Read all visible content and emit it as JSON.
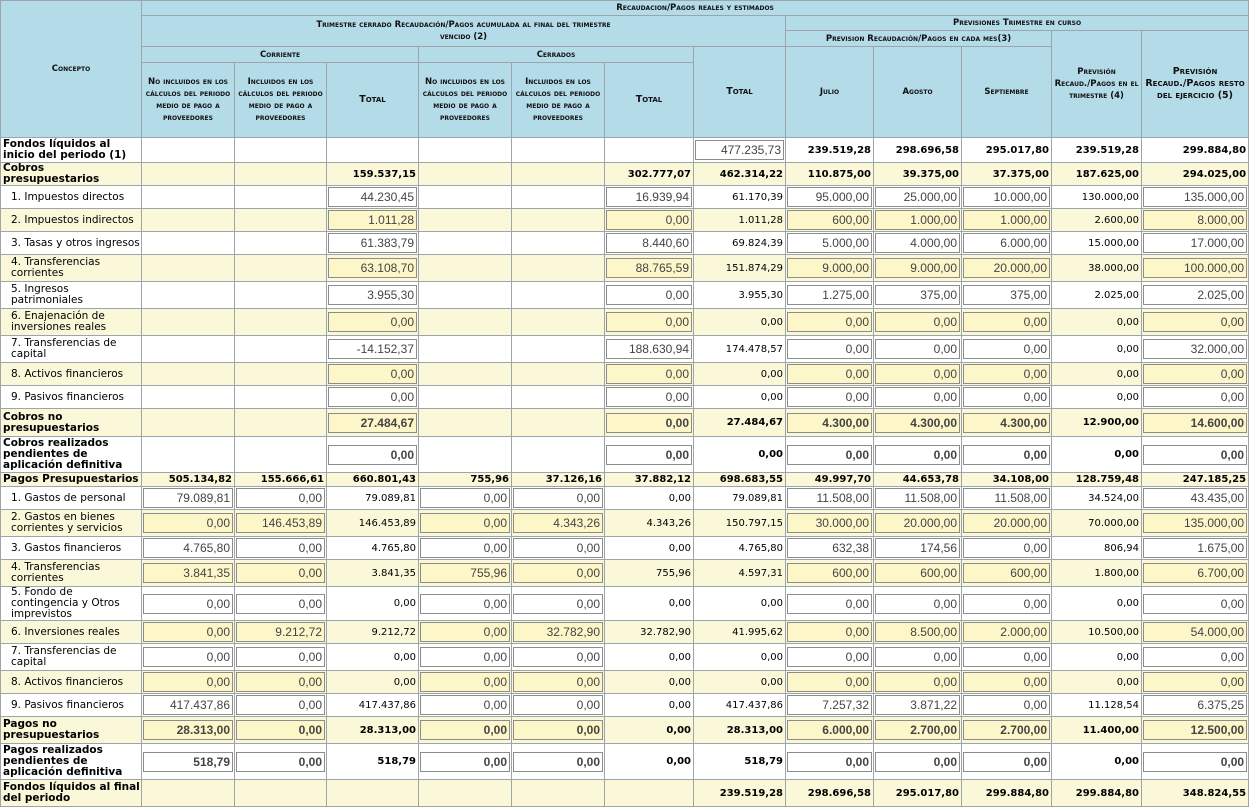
{
  "header": {
    "concepto": "Concepto",
    "main_title": "Recaudacion/Pagos reales y estimados",
    "trimestre_cerrado": "Trimestre cerrado Recaudación/Pagos acumulada al final del trimestre vencido (2)",
    "corriente": "Corriente",
    "cerrados": "Cerrados",
    "no_incluidos": "No incluidos en los cálculos del periodo medio de pago a proveedores",
    "incluidos": "Incluidos en los cálculos del periodo medio de pago a proveedores",
    "total": "Total",
    "previsiones": "Previsiones Trimestre en curso",
    "prevision_mes": "Prevision Recaudación/Pagos en cada mes(3)",
    "julio": "Julio",
    "agosto": "Agosto",
    "septiembre": "Septiembre",
    "prevision_trimestre": "Previsión Recaud./Pagos en el trimestre (4)",
    "prevision_resto": "Previsión Recaud./Pagos resto del ejercicio (5)"
  },
  "rows": [
    {
      "label": "Fondos líquidos al inicio del periodo (1)",
      "bold": true,
      "yellow": false,
      "cells": [
        "",
        "",
        "",
        "",
        "",
        "",
        "477.235,73",
        "239.519,28",
        "298.696,58",
        "295.017,80",
        "239.519,28",
        "299.884,80"
      ],
      "types": [
        "e",
        "e",
        "e",
        "e",
        "e",
        "e",
        "i",
        "b",
        "b",
        "b",
        "b",
        "b"
      ]
    },
    {
      "label": "Cobros presupuestarios",
      "bold": true,
      "yellow": true,
      "cells": [
        "",
        "",
        "159.537,15",
        "",
        "",
        "302.777,07",
        "462.314,22",
        "110.875,00",
        "39.375,00",
        "37.375,00",
        "187.625,00",
        "294.025,00"
      ],
      "types": [
        "e",
        "e",
        "b",
        "e",
        "e",
        "b",
        "b",
        "b",
        "b",
        "b",
        "b",
        "b"
      ]
    },
    {
      "label": "1. Impuestos directos",
      "bold": false,
      "yellow": false,
      "cells": [
        "",
        "",
        "44.230,45",
        "",
        "",
        "16.939,94",
        "61.170,39",
        "95.000,00",
        "25.000,00",
        "10.000,00",
        "130.000,00",
        "135.000,00"
      ],
      "types": [
        "e",
        "e",
        "i",
        "e",
        "e",
        "i",
        "v",
        "i",
        "i",
        "i",
        "v",
        "i"
      ]
    },
    {
      "label": "2. Impuestos indirectos",
      "bold": false,
      "yellow": true,
      "cells": [
        "",
        "",
        "1.011,28",
        "",
        "",
        "0,00",
        "1.011,28",
        "600,00",
        "1.000,00",
        "1.000,00",
        "2.600,00",
        "8.000,00"
      ],
      "types": [
        "e",
        "e",
        "i",
        "e",
        "e",
        "i",
        "v",
        "i",
        "i",
        "i",
        "v",
        "i"
      ]
    },
    {
      "label": "3. Tasas y otros ingresos",
      "bold": false,
      "yellow": false,
      "cells": [
        "",
        "",
        "61.383,79",
        "",
        "",
        "8.440,60",
        "69.824,39",
        "5.000,00",
        "4.000,00",
        "6.000,00",
        "15.000,00",
        "17.000,00"
      ],
      "types": [
        "e",
        "e",
        "i",
        "e",
        "e",
        "i",
        "v",
        "i",
        "i",
        "i",
        "v",
        "i"
      ]
    },
    {
      "label": "4. Transferencias corrientes",
      "bold": false,
      "yellow": true,
      "cells": [
        "",
        "",
        "63.108,70",
        "",
        "",
        "88.765,59",
        "151.874,29",
        "9.000,00",
        "9.000,00",
        "20.000,00",
        "38.000,00",
        "100.000,00"
      ],
      "types": [
        "e",
        "e",
        "i",
        "e",
        "e",
        "i",
        "v",
        "i",
        "i",
        "i",
        "v",
        "i"
      ]
    },
    {
      "label": "5. Ingresos patrimoniales",
      "bold": false,
      "yellow": false,
      "cells": [
        "",
        "",
        "3.955,30",
        "",
        "",
        "0,00",
        "3.955,30",
        "1.275,00",
        "375,00",
        "375,00",
        "2.025,00",
        "2.025,00"
      ],
      "types": [
        "e",
        "e",
        "i",
        "e",
        "e",
        "i",
        "v",
        "i",
        "i",
        "i",
        "v",
        "i"
      ]
    },
    {
      "label": "6. Enajenación de inversiones reales",
      "bold": false,
      "yellow": true,
      "cells": [
        "",
        "",
        "0,00",
        "",
        "",
        "0,00",
        "0,00",
        "0,00",
        "0,00",
        "0,00",
        "0,00",
        "0,00"
      ],
      "types": [
        "e",
        "e",
        "i",
        "e",
        "e",
        "i",
        "v",
        "i",
        "i",
        "i",
        "v",
        "i"
      ]
    },
    {
      "label": "7. Transferencias de capital",
      "bold": false,
      "yellow": false,
      "cells": [
        "",
        "",
        "-14.152,37",
        "",
        "",
        "188.630,94",
        "174.478,57",
        "0,00",
        "0,00",
        "0,00",
        "0,00",
        "32.000,00"
      ],
      "types": [
        "e",
        "e",
        "i",
        "e",
        "e",
        "i",
        "v",
        "i",
        "i",
        "i",
        "v",
        "i"
      ]
    },
    {
      "label": "8. Activos financieros",
      "bold": false,
      "yellow": true,
      "cells": [
        "",
        "",
        "0,00",
        "",
        "",
        "0,00",
        "0,00",
        "0,00",
        "0,00",
        "0,00",
        "0,00",
        "0,00"
      ],
      "types": [
        "e",
        "e",
        "i",
        "e",
        "e",
        "i",
        "v",
        "i",
        "i",
        "i",
        "v",
        "i"
      ]
    },
    {
      "label": "9. Pasivos financieros",
      "bold": false,
      "yellow": false,
      "cells": [
        "",
        "",
        "0,00",
        "",
        "",
        "0,00",
        "0,00",
        "0,00",
        "0,00",
        "0,00",
        "0,00",
        "0,00"
      ],
      "types": [
        "e",
        "e",
        "i",
        "e",
        "e",
        "i",
        "v",
        "i",
        "i",
        "i",
        "v",
        "i"
      ]
    },
    {
      "label": "Cobros no presupuestarios",
      "bold": true,
      "yellow": true,
      "cells": [
        "",
        "",
        "27.484,67",
        "",
        "",
        "0,00",
        "27.484,67",
        "4.300,00",
        "4.300,00",
        "4.300,00",
        "12.900,00",
        "14.600,00"
      ],
      "types": [
        "e",
        "e",
        "ib",
        "e",
        "e",
        "ib",
        "b",
        "ib",
        "ib",
        "ib",
        "b",
        "ib"
      ]
    },
    {
      "label": "Cobros realizados pendientes de aplicación definitiva",
      "bold": true,
      "yellow": false,
      "cells": [
        "",
        "",
        "0,00",
        "",
        "",
        "0,00",
        "0,00",
        "0,00",
        "0,00",
        "0,00",
        "0,00",
        "0,00"
      ],
      "types": [
        "e",
        "e",
        "ib",
        "e",
        "e",
        "ib",
        "b",
        "ib",
        "ib",
        "ib",
        "b",
        "ib"
      ]
    },
    {
      "label": "Pagos Presupuestarios",
      "bold": true,
      "yellow": true,
      "cells": [
        "505.134,82",
        "155.666,61",
        "660.801,43",
        "755,96",
        "37.126,16",
        "37.882,12",
        "698.683,55",
        "49.997,70",
        "44.653,78",
        "34.108,00",
        "128.759,48",
        "247.185,25"
      ],
      "types": [
        "b",
        "b",
        "b",
        "b",
        "b",
        "b",
        "b",
        "b",
        "b",
        "b",
        "b",
        "b"
      ]
    },
    {
      "label": "1. Gastos de personal",
      "bold": false,
      "yellow": false,
      "cells": [
        "79.089,81",
        "0,00",
        "79.089,81",
        "0,00",
        "0,00",
        "0,00",
        "79.089,81",
        "11.508,00",
        "11.508,00",
        "11.508,00",
        "34.524,00",
        "43.435,00"
      ],
      "types": [
        "i",
        "i",
        "v",
        "i",
        "i",
        "v",
        "v",
        "i",
        "i",
        "i",
        "v",
        "i"
      ]
    },
    {
      "label": "2. Gastos en bienes corrientes y servicios",
      "bold": false,
      "yellow": true,
      "cells": [
        "0,00",
        "146.453,89",
        "146.453,89",
        "0,00",
        "4.343,26",
        "4.343,26",
        "150.797,15",
        "30.000,00",
        "20.000,00",
        "20.000,00",
        "70.000,00",
        "135.000,00"
      ],
      "types": [
        "i",
        "i",
        "v",
        "i",
        "i",
        "v",
        "v",
        "i",
        "i",
        "i",
        "v",
        "i"
      ]
    },
    {
      "label": "3. Gastos financieros",
      "bold": false,
      "yellow": false,
      "cells": [
        "4.765,80",
        "0,00",
        "4.765,80",
        "0,00",
        "0,00",
        "0,00",
        "4.765,80",
        "632,38",
        "174,56",
        "0,00",
        "806,94",
        "1.675,00"
      ],
      "types": [
        "i",
        "i",
        "v",
        "i",
        "i",
        "v",
        "v",
        "i",
        "i",
        "i",
        "v",
        "i"
      ]
    },
    {
      "label": "4. Transferencias corrientes",
      "bold": false,
      "yellow": true,
      "cells": [
        "3.841,35",
        "0,00",
        "3.841,35",
        "755,96",
        "0,00",
        "755,96",
        "4.597,31",
        "600,00",
        "600,00",
        "600,00",
        "1.800,00",
        "6.700,00"
      ],
      "types": [
        "i",
        "i",
        "v",
        "i",
        "i",
        "v",
        "v",
        "i",
        "i",
        "i",
        "v",
        "i"
      ]
    },
    {
      "label": "5. Fondo de contingencia y Otros imprevistos",
      "bold": false,
      "yellow": false,
      "cells": [
        "0,00",
        "0,00",
        "0,00",
        "0,00",
        "0,00",
        "0,00",
        "0,00",
        "0,00",
        "0,00",
        "0,00",
        "0,00",
        "0,00"
      ],
      "types": [
        "i",
        "i",
        "v",
        "i",
        "i",
        "v",
        "v",
        "i",
        "i",
        "i",
        "v",
        "i"
      ]
    },
    {
      "label": "6. Inversiones reales",
      "bold": false,
      "yellow": true,
      "cells": [
        "0,00",
        "9.212,72",
        "9.212,72",
        "0,00",
        "32.782,90",
        "32.782,90",
        "41.995,62",
        "0,00",
        "8.500,00",
        "2.000,00",
        "10.500,00",
        "54.000,00"
      ],
      "types": [
        "i",
        "i",
        "v",
        "i",
        "i",
        "v",
        "v",
        "i",
        "i",
        "i",
        "v",
        "i"
      ]
    },
    {
      "label": "7. Transferencias de capital",
      "bold": false,
      "yellow": false,
      "cells": [
        "0,00",
        "0,00",
        "0,00",
        "0,00",
        "0,00",
        "0,00",
        "0,00",
        "0,00",
        "0,00",
        "0,00",
        "0,00",
        "0,00"
      ],
      "types": [
        "i",
        "i",
        "v",
        "i",
        "i",
        "v",
        "v",
        "i",
        "i",
        "i",
        "v",
        "i"
      ]
    },
    {
      "label": "8. Activos financieros",
      "bold": false,
      "yellow": true,
      "cells": [
        "0,00",
        "0,00",
        "0,00",
        "0,00",
        "0,00",
        "0,00",
        "0,00",
        "0,00",
        "0,00",
        "0,00",
        "0,00",
        "0,00"
      ],
      "types": [
        "i",
        "i",
        "v",
        "i",
        "i",
        "v",
        "v",
        "i",
        "i",
        "i",
        "v",
        "i"
      ]
    },
    {
      "label": "9. Pasivos financieros",
      "bold": false,
      "yellow": false,
      "cells": [
        "417.437,86",
        "0,00",
        "417.437,86",
        "0,00",
        "0,00",
        "0,00",
        "417.437,86",
        "7.257,32",
        "3.871,22",
        "0,00",
        "11.128,54",
        "6.375,25"
      ],
      "types": [
        "i",
        "i",
        "v",
        "i",
        "i",
        "v",
        "v",
        "i",
        "i",
        "i",
        "v",
        "i"
      ]
    },
    {
      "label": "Pagos no presupuestarios",
      "bold": true,
      "yellow": true,
      "cells": [
        "28.313,00",
        "0,00",
        "28.313,00",
        "0,00",
        "0,00",
        "0,00",
        "28.313,00",
        "6.000,00",
        "2.700,00",
        "2.700,00",
        "11.400,00",
        "12.500,00"
      ],
      "types": [
        "ib",
        "ib",
        "b",
        "ib",
        "ib",
        "b",
        "b",
        "ib",
        "ib",
        "ib",
        "b",
        "ib"
      ]
    },
    {
      "label": "Pagos realizados pendientes de aplicación definitiva",
      "bold": true,
      "yellow": false,
      "cells": [
        "518,79",
        "0,00",
        "518,79",
        "0,00",
        "0,00",
        "0,00",
        "518,79",
        "0,00",
        "0,00",
        "0,00",
        "0,00",
        "0,00"
      ],
      "types": [
        "ib",
        "ib",
        "b",
        "ib",
        "ib",
        "b",
        "b",
        "ib",
        "ib",
        "ib",
        "b",
        "ib"
      ]
    },
    {
      "label": "Fondos líquidos al final del periodo",
      "bold": true,
      "yellow": true,
      "cells": [
        "",
        "",
        "",
        "",
        "",
        "",
        "239.519,28",
        "298.696,58",
        "295.017,80",
        "299.884,80",
        "299.884,80",
        "348.824,55"
      ],
      "types": [
        "e",
        "e",
        "e",
        "e",
        "e",
        "e",
        "b",
        "b",
        "b",
        "b",
        "b",
        "b"
      ]
    }
  ]
}
